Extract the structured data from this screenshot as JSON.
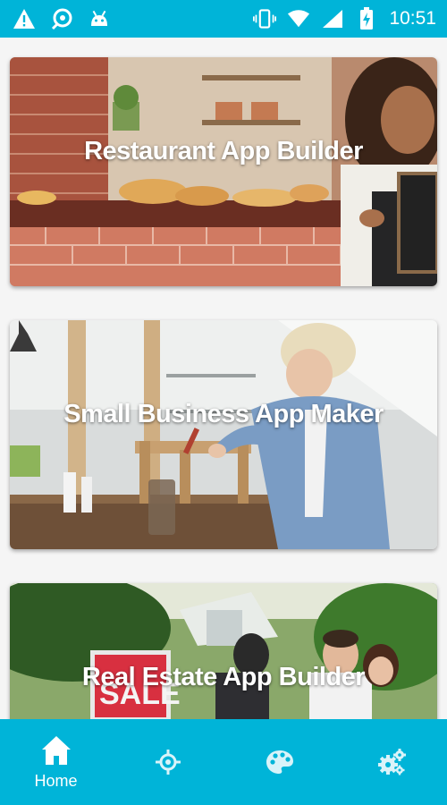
{
  "colors": {
    "accent": "#00b4d8",
    "background": "#f5f5f5",
    "text_on_accent": "#ffffff"
  },
  "status_bar": {
    "time": "10:51",
    "left_icons": [
      "warning-icon",
      "debug-icon",
      "android-icon"
    ],
    "right_icons": [
      "vibrate-icon",
      "wifi-icon",
      "signal-icon",
      "battery-charging-icon"
    ]
  },
  "cards": [
    {
      "title": "Restaurant App Builder",
      "image": "restaurant-photo"
    },
    {
      "title": "Small Business App Maker",
      "image": "workshop-photo"
    },
    {
      "title": "Real Estate App Builder",
      "image": "real-estate-photo"
    }
  ],
  "bottom_nav": {
    "items": [
      {
        "label": "Home",
        "icon": "home-icon",
        "active": true
      },
      {
        "label": "",
        "icon": "crosshair-icon",
        "active": false
      },
      {
        "label": "",
        "icon": "palette-icon",
        "active": false
      },
      {
        "label": "",
        "icon": "settings-gears-icon",
        "active": false
      }
    ]
  }
}
